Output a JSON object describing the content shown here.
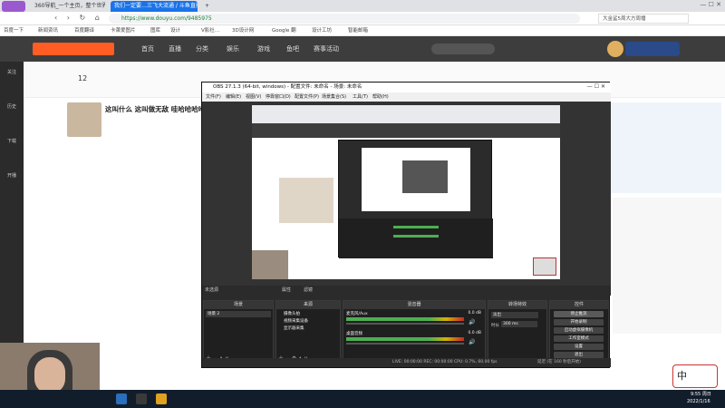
{
  "browser": {
    "tabs": [
      "360导航_一个主页，整个世界",
      "我们一定要…三飞大流通 / 斗鱼直播",
      "+"
    ],
    "url": "https://www.douyu.com/9485975",
    "search_placeholder": "大金鲨5周大方周播",
    "bookmarks": [
      "百度一下",
      "新闻资讯",
      "百度翻译",
      "卡萧爱图片",
      "图库",
      "设计",
      "V影社…",
      "3D设计网",
      "Google 翻",
      "设计工坊",
      "智能邮箱"
    ]
  },
  "douyu": {
    "nav": [
      "首页",
      "直播",
      "分类",
      "娱乐",
      "游戏",
      "鱼吧",
      "赛事活动"
    ],
    "room_title": "这叫什么 这叫做无敌 哇哈哈哈哈",
    "count_a": "12",
    "sidebar": [
      "关注",
      "历史",
      "下载",
      "开播"
    ]
  },
  "obs": {
    "title": "OBS 27.1.3 (64-bit, windows) - 配置文件: 未命名 - 场景: 未命名",
    "menu": [
      "文件(F)",
      "编辑(E)",
      "视图(V)",
      "停靠窗口(D)",
      "配置文件(P)",
      "场景集合(S)",
      "工具(T)",
      "帮助(H)"
    ],
    "source_none": "未选源",
    "prop_btn": "属性",
    "filter_btn": "滤镜",
    "panels": {
      "scenes": "场景",
      "sources": "来源",
      "mixer": "混音器",
      "transitions": "转场特效",
      "controls": "控件"
    },
    "scene_item": "场景 2",
    "sources": [
      "摄像头拍",
      "视频采集设备",
      "显示器采集"
    ],
    "mixer_tracks": [
      {
        "name": "麦克风/Aux",
        "db": "0.0 dB"
      },
      {
        "name": "桌面音频",
        "db": "0.0 dB"
      }
    ],
    "transition": "淡出",
    "duration_label": "时长",
    "duration": "300 ms",
    "controls": [
      "停止推流",
      "开始录制",
      "启动虚拟摄像机",
      "工作室模式",
      "设置",
      "退出"
    ],
    "status": "LIVE: 00:00:00   REC: 00:00:00   CPU: 0.7%, 60.00 fps",
    "status_right": "延迟 (在 160 秒后开始)"
  },
  "taskbar": {
    "time": "9:55 周日",
    "date": "2022/1/16",
    "ime": "中"
  },
  "colors": {
    "obs_bg": "#2b2b2b",
    "douyu_orange": "#ff5d23",
    "meter_green": "#4caf50",
    "meter_yellow": "#d4b106"
  }
}
